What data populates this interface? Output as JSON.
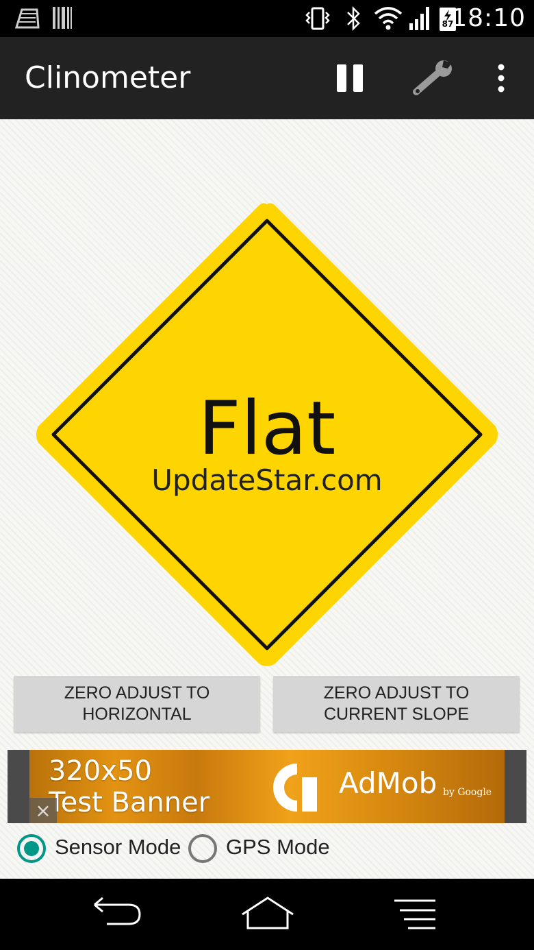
{
  "status_bar": {
    "time": "18:10",
    "battery_level": "87",
    "icons": [
      "notification-app-icon",
      "barcode-icon",
      "vibrate-icon",
      "bluetooth-icon",
      "wifi-icon",
      "signal-icon",
      "battery-icon"
    ]
  },
  "app_bar": {
    "title": "Clinometer",
    "actions": [
      "pause-icon",
      "wrench-icon",
      "overflow-menu-icon"
    ]
  },
  "sign": {
    "label": "Flat",
    "watermark": "UpdateStar.com",
    "fill_color": "#ffd500",
    "border_color": "#111111"
  },
  "buttons": {
    "zero_horizontal": {
      "line1": "ZERO ADJUST TO",
      "line2": "HORIZONTAL"
    },
    "zero_slope": {
      "line1": "ZERO ADJUST TO",
      "line2": "CURRENT SLOPE"
    }
  },
  "ad": {
    "line1": "320x50",
    "line2": "Test Banner",
    "brand": "AdMob",
    "by": "by Google",
    "close": "×"
  },
  "modes": {
    "sensor_label": "Sensor Mode",
    "sensor_selected": true,
    "gps_label": "GPS Mode",
    "gps_selected": false,
    "accent_color": "#009688"
  },
  "nav_bar": {
    "buttons": [
      "back-icon",
      "home-icon",
      "recents-icon"
    ]
  }
}
